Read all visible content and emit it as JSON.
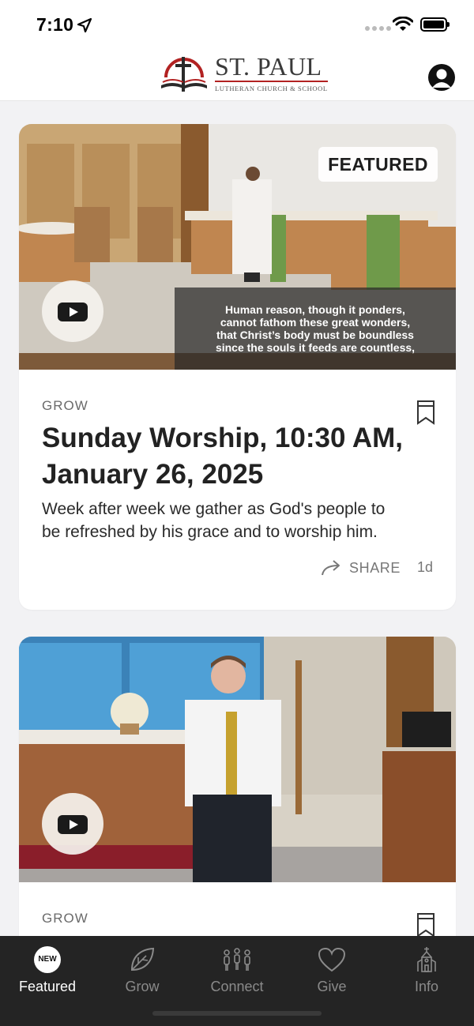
{
  "status": {
    "time": "7:10"
  },
  "header": {
    "logo_name": "ST. PAUL",
    "logo_sub": "LUTHERAN CHURCH & SCHOOL"
  },
  "feed": [
    {
      "badge": "FEATURED",
      "caption": [
        "Human reason, though it ponders,",
        "cannot fathom these great wonders,",
        "that Christ’s body must be boundless",
        "since the souls it feeds are countless,"
      ],
      "category": "GROW",
      "title": "Sunday Worship, 10:30 AM, January 26, 2025",
      "description": "Week after week we gather as God's people to be refreshed by his grace and to worship him.",
      "share_label": "SHARE",
      "age": "1d"
    },
    {
      "category": "GROW"
    }
  ],
  "tabs": [
    {
      "label": "Featured",
      "badge": "NEW",
      "icon": "new-badge",
      "active": true
    },
    {
      "label": "Grow",
      "icon": "leaf-icon"
    },
    {
      "label": "Connect",
      "icon": "people-icon"
    },
    {
      "label": "Give",
      "icon": "heart-icon"
    },
    {
      "label": "Info",
      "icon": "church-icon"
    }
  ],
  "colors": {
    "accent": "#b22222",
    "tabbar": "#242424",
    "background": "#f2f2f4"
  }
}
